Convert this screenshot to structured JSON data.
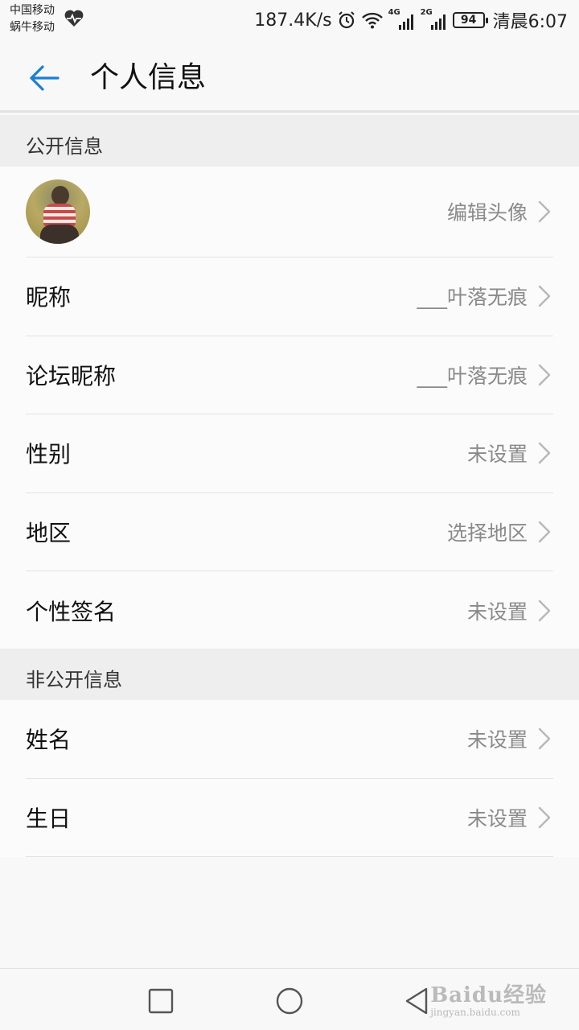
{
  "status_bar": {
    "carrier_1": "中国移动",
    "carrier_2": "蜗牛移动",
    "net_speed": "187.4K/s",
    "sim1_type": "4G",
    "sim2_type": "2G",
    "battery": "94",
    "time": "清晨6:07"
  },
  "header": {
    "title": "个人信息"
  },
  "public_section": {
    "title": "公开信息",
    "avatar_row": {
      "value": "编辑头像"
    },
    "rows": [
      {
        "label": "昵称",
        "value": "___叶落无痕"
      },
      {
        "label": "论坛昵称",
        "value": "___叶落无痕"
      },
      {
        "label": "性别",
        "value": "未设置"
      },
      {
        "label": "地区",
        "value": "选择地区"
      },
      {
        "label": "个性签名",
        "value": "未设置"
      }
    ]
  },
  "private_section": {
    "title": "非公开信息",
    "rows": [
      {
        "label": "姓名",
        "value": "未设置"
      },
      {
        "label": "生日",
        "value": "未设置"
      }
    ]
  },
  "watermark": {
    "brand": "Baidu经验",
    "url": "jingyan.baidu.com"
  },
  "colors": {
    "accent": "#1a7fd4",
    "value_text": "#8a8a8a",
    "section_bg": "#eeeeee"
  }
}
